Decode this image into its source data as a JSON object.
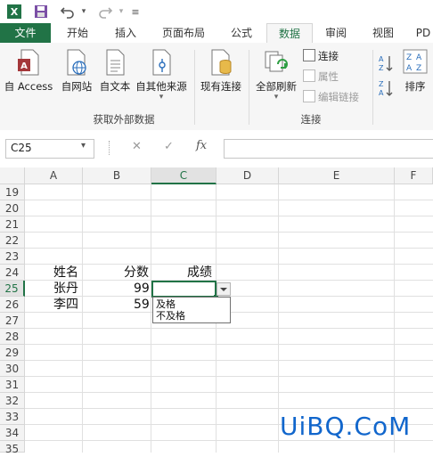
{
  "qat": {
    "icons": [
      "excel-logo-icon",
      "save-icon",
      "undo-icon",
      "redo-icon",
      "customize-icon"
    ]
  },
  "tabs": [
    {
      "label": "文件"
    },
    {
      "label": "开始"
    },
    {
      "label": "插入"
    },
    {
      "label": "页面布局"
    },
    {
      "label": "公式"
    },
    {
      "label": "数据"
    },
    {
      "label": "审阅"
    },
    {
      "label": "视图"
    },
    {
      "label": "PD"
    }
  ],
  "ribbon": {
    "external_buttons": [
      {
        "label": "自 Access"
      },
      {
        "label": "自网站"
      },
      {
        "label": "自文本"
      },
      {
        "label": "自其他来源"
      },
      {
        "label": "现有连接"
      }
    ],
    "external_group_label": "获取外部数据",
    "refresh_all_label": "全部刷新",
    "connections_items": [
      {
        "label": "连接"
      },
      {
        "label": "属性"
      },
      {
        "label": "编辑链接"
      }
    ],
    "connections_group_label": "连接",
    "sort_label": "排序"
  },
  "formula_bar": {
    "name_box": "C25",
    "cancel_symbol": "✕",
    "enter_symbol": "✓",
    "fx_symbol": "fx",
    "formula_value": ""
  },
  "grid": {
    "columns": [
      "A",
      "B",
      "C",
      "D",
      "E",
      "F"
    ],
    "rows": [
      "19",
      "20",
      "21",
      "22",
      "23",
      "24",
      "25",
      "26",
      "27",
      "28",
      "29",
      "30",
      "31",
      "32",
      "33",
      "34",
      "35"
    ],
    "cells": {
      "A24": "姓名",
      "B24": "分数",
      "C24": "成绩",
      "A25": "张丹",
      "B25": "99",
      "A26": "李四",
      "B26": "59"
    },
    "dropdown_options": [
      "及格",
      "不及格"
    ]
  },
  "watermark": "UiBQ.CoM",
  "colors": {
    "accent": "#217346",
    "watermark": "#1166cc"
  }
}
